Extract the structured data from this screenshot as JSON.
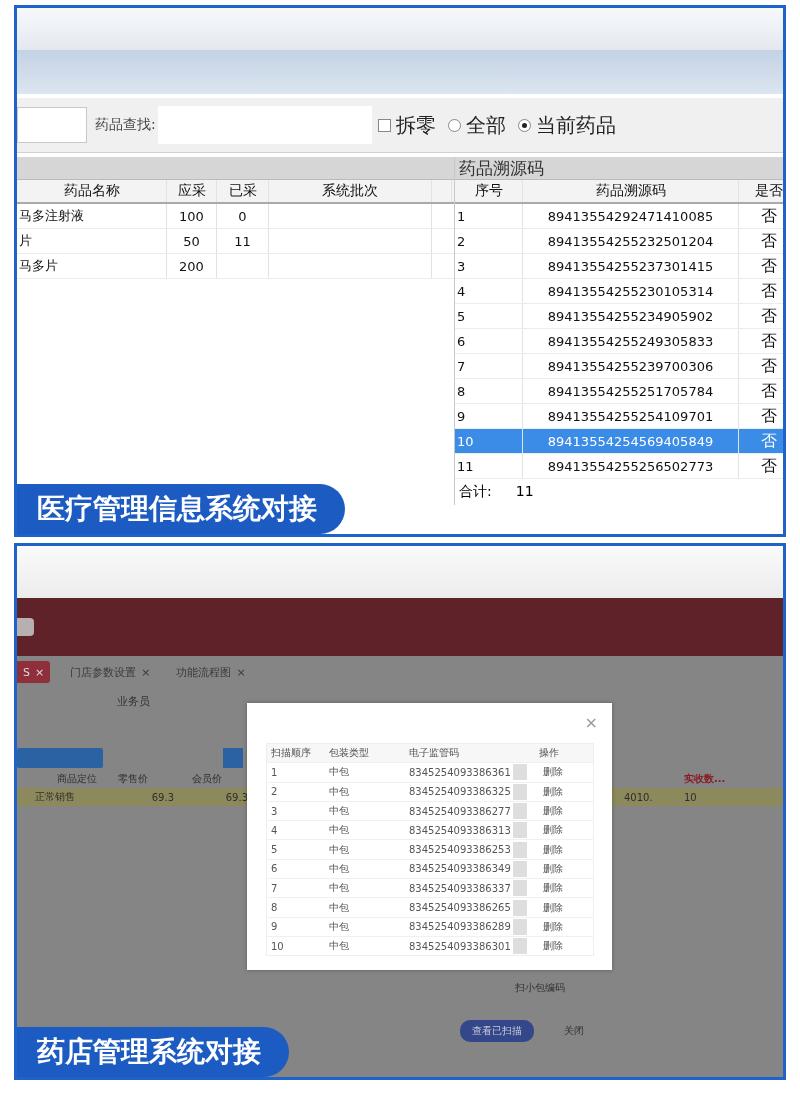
{
  "his_screen": {
    "toolbar": {
      "search_label": "药品查找:",
      "split_checkbox": {
        "label": "拆零",
        "checked": false
      },
      "scope_options": [
        {
          "label": "全部",
          "selected": false
        },
        {
          "label": "当前药品",
          "selected": true
        }
      ]
    },
    "drug_table": {
      "columns": [
        "药品名称",
        "应采",
        "已采",
        "系统批次"
      ],
      "rows": [
        {
          "name": "马多注射液",
          "planned": "100",
          "collected": "0"
        },
        {
          "name": "片",
          "planned": "50",
          "collected": "11"
        },
        {
          "name": "马多片",
          "planned": "200"
        }
      ]
    },
    "trace_table": {
      "title": "药品溯源码",
      "columns": [
        "序号",
        "药品溯源码",
        "是否"
      ],
      "rows": [
        {
          "index": "1",
          "code": "89413554292471410085",
          "flag": "否",
          "selected": false
        },
        {
          "index": "2",
          "code": "89413554255232501204",
          "flag": "否",
          "selected": false
        },
        {
          "index": "3",
          "code": "89413554255237301415",
          "flag": "否",
          "selected": false
        },
        {
          "index": "4",
          "code": "89413554255230105314",
          "flag": "否",
          "selected": false
        },
        {
          "index": "5",
          "code": "89413554255234905902",
          "flag": "否",
          "selected": false
        },
        {
          "index": "6",
          "code": "89413554255249305833",
          "flag": "否",
          "selected": false
        },
        {
          "index": "7",
          "code": "89413554255239700306",
          "flag": "否",
          "selected": false
        },
        {
          "index": "8",
          "code": "89413554255251705784",
          "flag": "否",
          "selected": false
        },
        {
          "index": "9",
          "code": "89413554255254109701",
          "flag": "否",
          "selected": false
        },
        {
          "index": "10",
          "code": "89413554254569405849",
          "flag": "否",
          "selected": true
        },
        {
          "index": "11",
          "code": "89413554255256502773",
          "flag": "否",
          "selected": false
        }
      ],
      "total_label": "合计:",
      "total": "11"
    },
    "caption": "医疗管理信息系统对接"
  },
  "pharmacy_screen": {
    "tabs": [
      {
        "label": "S",
        "close": "×",
        "selected": true
      },
      {
        "label": "门店参数设置",
        "close": "×",
        "selected": false
      },
      {
        "label": "功能流程图",
        "close": "×",
        "selected": false
      }
    ],
    "salesperson_label": "业务员",
    "goods_table": {
      "columns": [
        "商品定位",
        "零售价",
        "会员价"
      ],
      "row": [
        "正常销售",
        "69.3",
        "69.3"
      ]
    },
    "right_table": {
      "column": "实收数...",
      "date_value": "4010.",
      "received": "10"
    },
    "scan_dialog": {
      "close": "×",
      "columns": [
        "扫描顺序",
        "包装类型",
        "电子监管码",
        "操作"
      ],
      "rows": [
        {
          "index": "1",
          "pack": "中包",
          "code": "8345254093386361",
          "action": "删除"
        },
        {
          "index": "2",
          "pack": "中包",
          "code": "8345254093386325",
          "action": "删除"
        },
        {
          "index": "3",
          "pack": "中包",
          "code": "8345254093386277",
          "action": "删除"
        },
        {
          "index": "4",
          "pack": "中包",
          "code": "8345254093386313",
          "action": "删除"
        },
        {
          "index": "5",
          "pack": "中包",
          "code": "8345254093386253",
          "action": "删除"
        },
        {
          "index": "6",
          "pack": "中包",
          "code": "8345254093386349",
          "action": "删除"
        },
        {
          "index": "7",
          "pack": "中包",
          "code": "8345254093386337",
          "action": "删除"
        },
        {
          "index": "8",
          "pack": "中包",
          "code": "8345254093386265",
          "action": "删除"
        },
        {
          "index": "9",
          "pack": "中包",
          "code": "8345254093386289",
          "action": "删除"
        },
        {
          "index": "10",
          "pack": "中包",
          "code": "8345254093386301",
          "action": "删除"
        }
      ]
    },
    "scan_small_label": "扫小包编码",
    "buttons": [
      {
        "label": "查看已扫描",
        "kind": "primary"
      },
      {
        "label": "关闭",
        "kind": "plain"
      }
    ],
    "caption": "药店管理系统对接"
  }
}
